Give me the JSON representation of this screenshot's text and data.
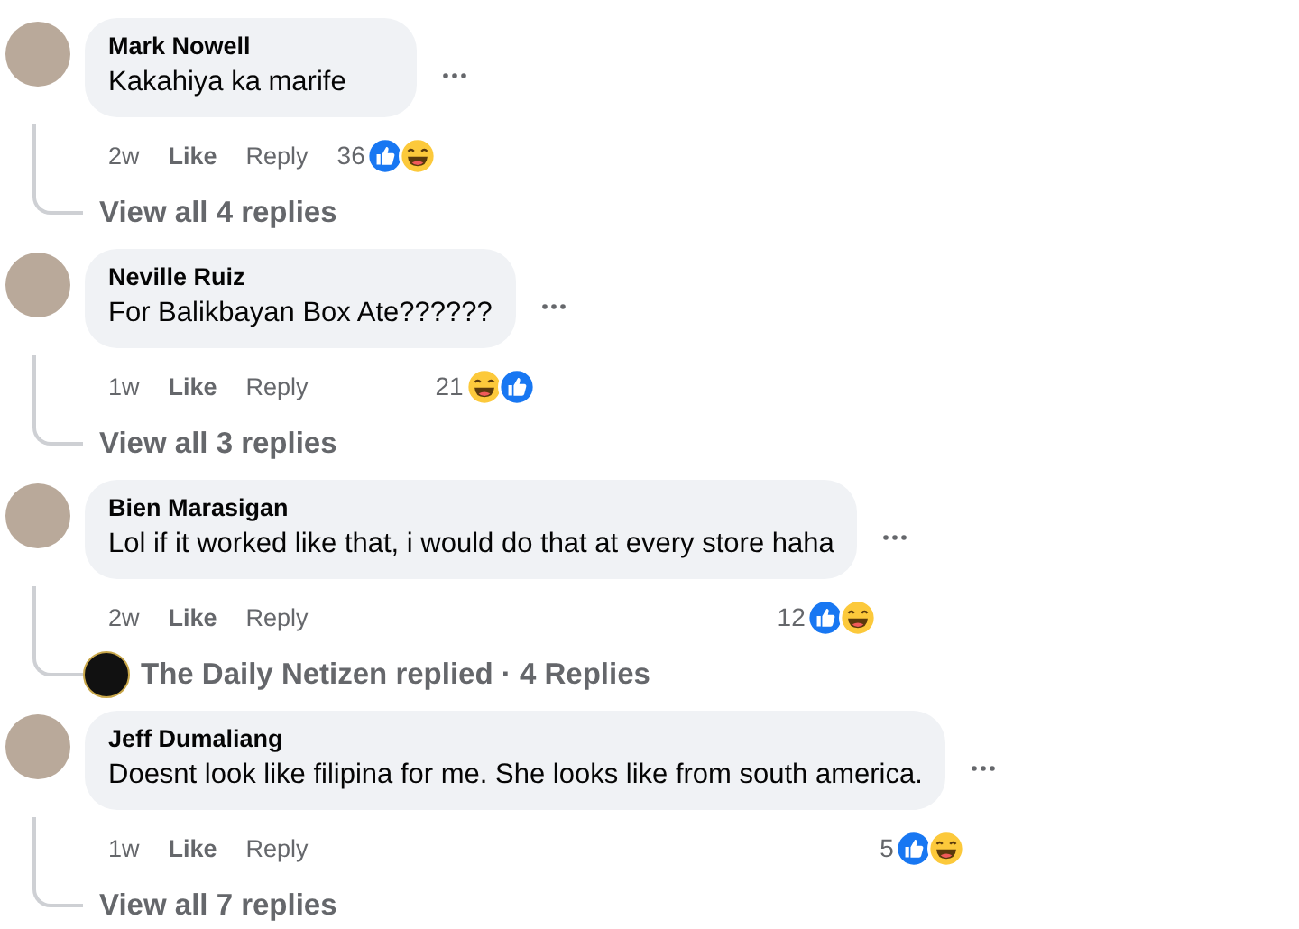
{
  "comments": [
    {
      "author": "Mark Nowell",
      "text": "Kakahiya ka marife",
      "time": "2w",
      "like": "Like",
      "reply": "Reply",
      "reaction_count": "36",
      "reactions": [
        {
          "kind": "like"
        },
        {
          "kind": "haha"
        }
      ],
      "replies": {
        "kind": "view_all",
        "text": "View all 4 replies"
      }
    },
    {
      "author": "Neville Ruiz",
      "text": "For Balikbayan Box Ate??????",
      "time": "1w",
      "like": "Like",
      "reply": "Reply",
      "reaction_count": "21",
      "reactions": [
        {
          "kind": "haha"
        },
        {
          "kind": "like"
        }
      ],
      "replies": {
        "kind": "view_all",
        "text": "View all 3 replies"
      }
    },
    {
      "author": "Bien Marasigan",
      "text": "Lol if it worked like that, i would do that at every store haha",
      "time": "2w",
      "like": "Like",
      "reply": "Reply",
      "reaction_count": "12",
      "reactions": [
        {
          "kind": "like"
        },
        {
          "kind": "haha"
        }
      ],
      "replies": {
        "kind": "page_replied",
        "text": "The Daily Netizen replied · 4 Replies"
      }
    },
    {
      "author": "Jeff Dumaliang",
      "text": "Doesnt look like filipina for me. She looks like from south america.",
      "time": "1w",
      "like": "Like",
      "reply": "Reply",
      "reaction_count": "5",
      "reactions": [
        {
          "kind": "like"
        },
        {
          "kind": "haha"
        }
      ],
      "replies": {
        "kind": "view_all",
        "text": "View all 7 replies"
      }
    }
  ]
}
